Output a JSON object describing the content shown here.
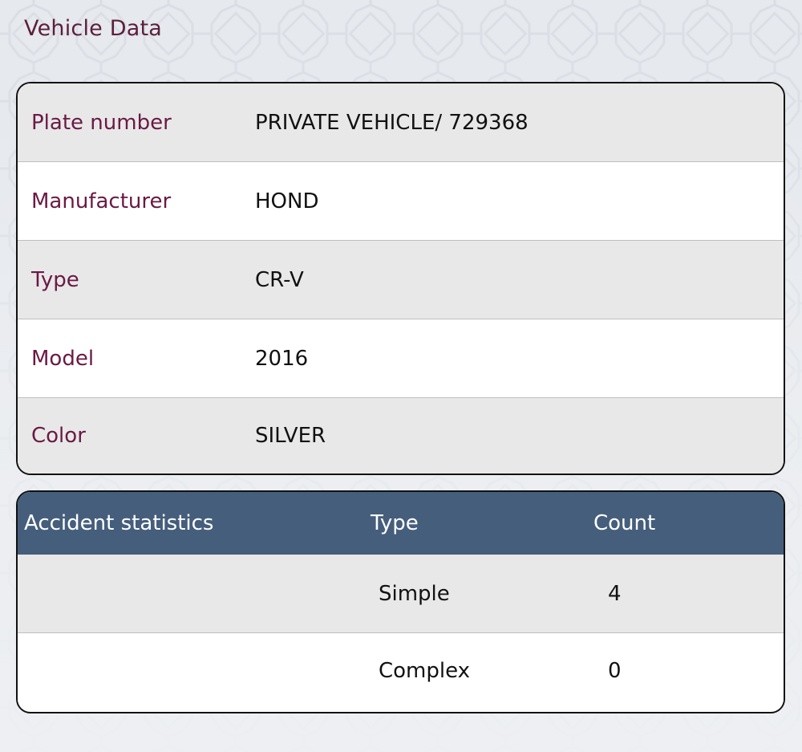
{
  "section_title": "Vehicle Data",
  "vehicle": {
    "rows": [
      {
        "label": "Plate number",
        "value": "PRIVATE VEHICLE/ 729368"
      },
      {
        "label": "Manufacturer",
        "value": "HOND"
      },
      {
        "label": "Type",
        "value": "CR-V"
      },
      {
        "label": "Model",
        "value": "2016"
      },
      {
        "label": "Color",
        "value": "SILVER"
      }
    ]
  },
  "accidents": {
    "header": {
      "title": "Accident statistics",
      "type": "Type",
      "count": "Count"
    },
    "rows": [
      {
        "type": "Simple",
        "count": "4"
      },
      {
        "type": "Complex",
        "count": "0"
      }
    ]
  },
  "colors": {
    "label_maroon": "#6a1a44",
    "header_blue": "#455e7c",
    "row_shaded": "#e8e8e8"
  }
}
